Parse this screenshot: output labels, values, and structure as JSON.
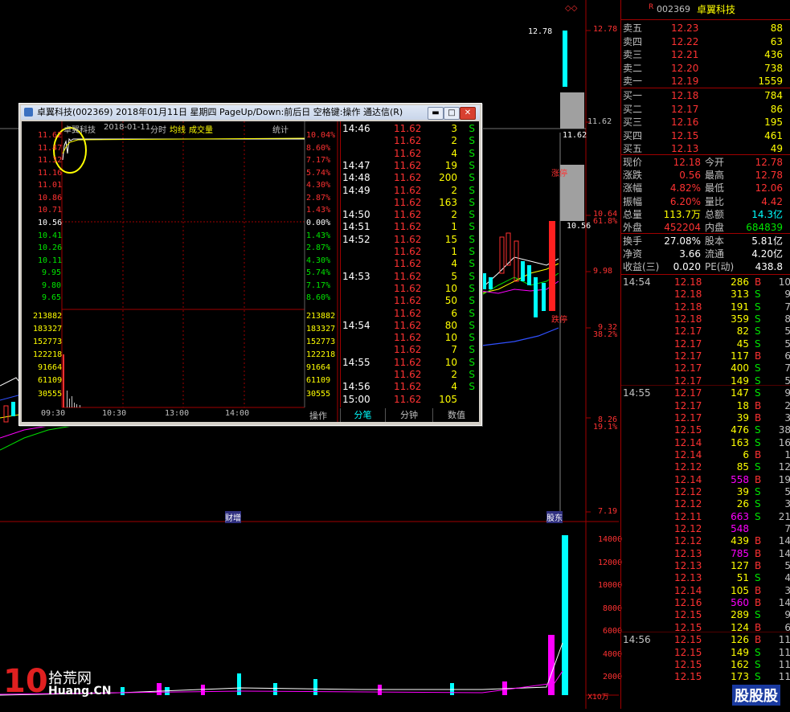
{
  "stock": {
    "code": "002369",
    "name": "卓翼科技",
    "marker": "R"
  },
  "main_chart": {
    "price_axis": [
      "12.78",
      "11.62",
      "10.64",
      "9.98",
      "9.32",
      "8.26",
      "7.19"
    ],
    "pct_axis": [
      "61.8%",
      "38.2%",
      "19.1%"
    ],
    "price_tags": [
      "12.78",
      "11.62",
      "10.56"
    ],
    "events": [
      "涨停",
      "跌停",
      "涨停"
    ],
    "marks": [
      "财增",
      "股东"
    ],
    "vol_axis": [
      "14000",
      "12000",
      "10000",
      "8000",
      "6000",
      "4000",
      "2000"
    ],
    "vol_unit": "X10万"
  },
  "popup": {
    "title": "卓翼科技(002369) 2018年01月11日 星期四 PageUp/Down:前后日 空格键:操作 通达信(R)",
    "chart_header": {
      "name": "卓翼科技",
      "date": "2018-01-11",
      "mode": "分时",
      "avg": "均线",
      "vol": "成交量",
      "stats": "统计"
    },
    "left_prices": [
      "11.62",
      "11.47",
      "11.32",
      "11.16",
      "11.01",
      "10.86",
      "10.71",
      "10.56",
      "10.41",
      "10.26",
      "10.11",
      "9.95",
      "9.80",
      "9.65"
    ],
    "right_pcts": [
      "10.04%",
      "8.60%",
      "7.17%",
      "5.74%",
      "4.30%",
      "2.87%",
      "1.43%",
      "0.00%",
      "1.43%",
      "2.87%",
      "4.30%",
      "5.74%",
      "7.17%",
      "8.60%"
    ],
    "vol_levels": [
      "213882",
      "183327",
      "152773",
      "122218",
      "91664",
      "61109",
      "30555"
    ],
    "time_axis": [
      "09:30",
      "10:30",
      "13:00",
      "14:00"
    ],
    "op_label": "操作",
    "ticks": [
      {
        "t": "14:46",
        "p": "11.62",
        "v": "3",
        "s": "S"
      },
      {
        "t": "",
        "p": "11.62",
        "v": "2",
        "s": "S"
      },
      {
        "t": "",
        "p": "11.62",
        "v": "4",
        "s": "S"
      },
      {
        "t": "14:47",
        "p": "11.62",
        "v": "19",
        "s": "S"
      },
      {
        "t": "14:48",
        "p": "11.62",
        "v": "200",
        "s": "S"
      },
      {
        "t": "14:49",
        "p": "11.62",
        "v": "2",
        "s": "S"
      },
      {
        "t": "",
        "p": "11.62",
        "v": "163",
        "s": "S"
      },
      {
        "t": "14:50",
        "p": "11.62",
        "v": "2",
        "s": "S"
      },
      {
        "t": "14:51",
        "p": "11.62",
        "v": "1",
        "s": "S"
      },
      {
        "t": "14:52",
        "p": "11.62",
        "v": "15",
        "s": "S"
      },
      {
        "t": "",
        "p": "11.62",
        "v": "1",
        "s": "S"
      },
      {
        "t": "",
        "p": "11.62",
        "v": "4",
        "s": "S"
      },
      {
        "t": "14:53",
        "p": "11.62",
        "v": "5",
        "s": "S"
      },
      {
        "t": "",
        "p": "11.62",
        "v": "10",
        "s": "S"
      },
      {
        "t": "",
        "p": "11.62",
        "v": "50",
        "s": "S"
      },
      {
        "t": "",
        "p": "11.62",
        "v": "6",
        "s": "S"
      },
      {
        "t": "14:54",
        "p": "11.62",
        "v": "80",
        "s": "S"
      },
      {
        "t": "",
        "p": "11.62",
        "v": "10",
        "s": "S"
      },
      {
        "t": "",
        "p": "11.62",
        "v": "7",
        "s": "S"
      },
      {
        "t": "14:55",
        "p": "11.62",
        "v": "10",
        "s": "S"
      },
      {
        "t": "",
        "p": "11.62",
        "v": "2",
        "s": "S"
      },
      {
        "t": "14:56",
        "p": "11.62",
        "v": "4",
        "s": "S"
      },
      {
        "t": "15:00",
        "p": "11.62",
        "v": "105",
        "s": ""
      }
    ],
    "tabs": [
      "分笔",
      "分钟",
      "数值"
    ]
  },
  "orderbook": {
    "asks": [
      {
        "label": "卖五",
        "price": "12.23",
        "vol": "88"
      },
      {
        "label": "卖四",
        "price": "12.22",
        "vol": "63"
      },
      {
        "label": "卖三",
        "price": "12.21",
        "vol": "436"
      },
      {
        "label": "卖二",
        "price": "12.20",
        "vol": "738"
      },
      {
        "label": "卖一",
        "price": "12.19",
        "vol": "1559"
      }
    ],
    "bids": [
      {
        "label": "买一",
        "price": "12.18",
        "vol": "784"
      },
      {
        "label": "买二",
        "price": "12.17",
        "vol": "86"
      },
      {
        "label": "买三",
        "price": "12.16",
        "vol": "195"
      },
      {
        "label": "买四",
        "price": "12.15",
        "vol": "461"
      },
      {
        "label": "买五",
        "price": "12.13",
        "vol": "49"
      }
    ]
  },
  "quote": [
    {
      "l1": "现价",
      "v1": "12.18",
      "l2": "今开",
      "v2": "12.78"
    },
    {
      "l1": "涨跌",
      "v1": "0.56",
      "l2": "最高",
      "v2": "12.78"
    },
    {
      "l1": "涨幅",
      "v1": "4.82%",
      "l2": "最低",
      "v2": "12.06"
    },
    {
      "l1": "振幅",
      "v1": "6.20%",
      "l2": "量比",
      "v2": "4.42"
    },
    {
      "l1": "总量",
      "v1": "113.7万",
      "l2": "总额",
      "v2": "14.3亿"
    },
    {
      "l1": "外盘",
      "v1": "452204",
      "l2": "内盘",
      "v2": "684839"
    }
  ],
  "fundamentals": [
    {
      "l1": "换手",
      "v1": "27.08%",
      "l2": "股本",
      "v2": "5.81亿"
    },
    {
      "l1": "净资",
      "v1": "3.66",
      "l2": "流通",
      "v2": "4.20亿"
    },
    {
      "l1": "收益(三)",
      "v1": "0.020",
      "l2": "PE(动)",
      "v2": "438.8"
    }
  ],
  "trades": [
    {
      "t": "14:54",
      "p": "12.18",
      "v": "286",
      "s": "B",
      "n": "10"
    },
    {
      "t": "",
      "p": "12.18",
      "v": "313",
      "s": "S",
      "n": "9"
    },
    {
      "t": "",
      "p": "12.18",
      "v": "191",
      "s": "S",
      "n": "7"
    },
    {
      "t": "",
      "p": "12.18",
      "v": "359",
      "s": "S",
      "n": "8"
    },
    {
      "t": "",
      "p": "12.17",
      "v": "82",
      "s": "S",
      "n": "5"
    },
    {
      "t": "",
      "p": "12.17",
      "v": "45",
      "s": "S",
      "n": "5"
    },
    {
      "t": "",
      "p": "12.17",
      "v": "117",
      "s": "B",
      "n": "6"
    },
    {
      "t": "",
      "p": "12.17",
      "v": "400",
      "s": "S",
      "n": "7"
    },
    {
      "t": "",
      "p": "12.17",
      "v": "149",
      "s": "S",
      "n": "5"
    },
    {
      "t": "14:55",
      "p": "12.17",
      "v": "147",
      "s": "S",
      "n": "9"
    },
    {
      "t": "",
      "p": "12.17",
      "v": "18",
      "s": "B",
      "n": "2"
    },
    {
      "t": "",
      "p": "12.17",
      "v": "39",
      "s": "B",
      "n": "3"
    },
    {
      "t": "",
      "p": "12.15",
      "v": "476",
      "s": "S",
      "n": "38"
    },
    {
      "t": "",
      "p": "12.14",
      "v": "163",
      "s": "S",
      "n": "16"
    },
    {
      "t": "",
      "p": "12.14",
      "v": "6",
      "s": "B",
      "n": "1"
    },
    {
      "t": "",
      "p": "12.12",
      "v": "85",
      "s": "S",
      "n": "12"
    },
    {
      "t": "",
      "p": "12.14",
      "v": "558",
      "s": "B",
      "n": "19"
    },
    {
      "t": "",
      "p": "12.12",
      "v": "39",
      "s": "S",
      "n": "5"
    },
    {
      "t": "",
      "p": "12.12",
      "v": "26",
      "s": "S",
      "n": "3"
    },
    {
      "t": "",
      "p": "12.11",
      "v": "663",
      "s": "S",
      "n": "21"
    },
    {
      "t": "",
      "p": "12.12",
      "v": "548",
      "s": "",
      "n": "7"
    },
    {
      "t": "",
      "p": "12.12",
      "v": "439",
      "s": "B",
      "n": "14"
    },
    {
      "t": "",
      "p": "12.13",
      "v": "785",
      "s": "B",
      "n": "14"
    },
    {
      "t": "",
      "p": "12.13",
      "v": "127",
      "s": "B",
      "n": "5"
    },
    {
      "t": "",
      "p": "12.13",
      "v": "51",
      "s": "S",
      "n": "4"
    },
    {
      "t": "",
      "p": "12.14",
      "v": "105",
      "s": "B",
      "n": "3"
    },
    {
      "t": "",
      "p": "12.16",
      "v": "560",
      "s": "B",
      "n": "14"
    },
    {
      "t": "",
      "p": "12.15",
      "v": "289",
      "s": "S",
      "n": "9"
    },
    {
      "t": "",
      "p": "12.15",
      "v": "124",
      "s": "B",
      "n": "6"
    },
    {
      "t": "14:56",
      "p": "12.15",
      "v": "126",
      "s": "B",
      "n": "11"
    },
    {
      "t": "",
      "p": "12.15",
      "v": "149",
      "s": "S",
      "n": "11"
    },
    {
      "t": "",
      "p": "12.15",
      "v": "162",
      "s": "S",
      "n": "11"
    },
    {
      "t": "",
      "p": "12.15",
      "v": "173",
      "s": "S",
      "n": "11"
    }
  ],
  "watermark": {
    "left": "拾荒网",
    "left_sub": "Huang.CN",
    "left_num": "10",
    "right": "股股股"
  }
}
